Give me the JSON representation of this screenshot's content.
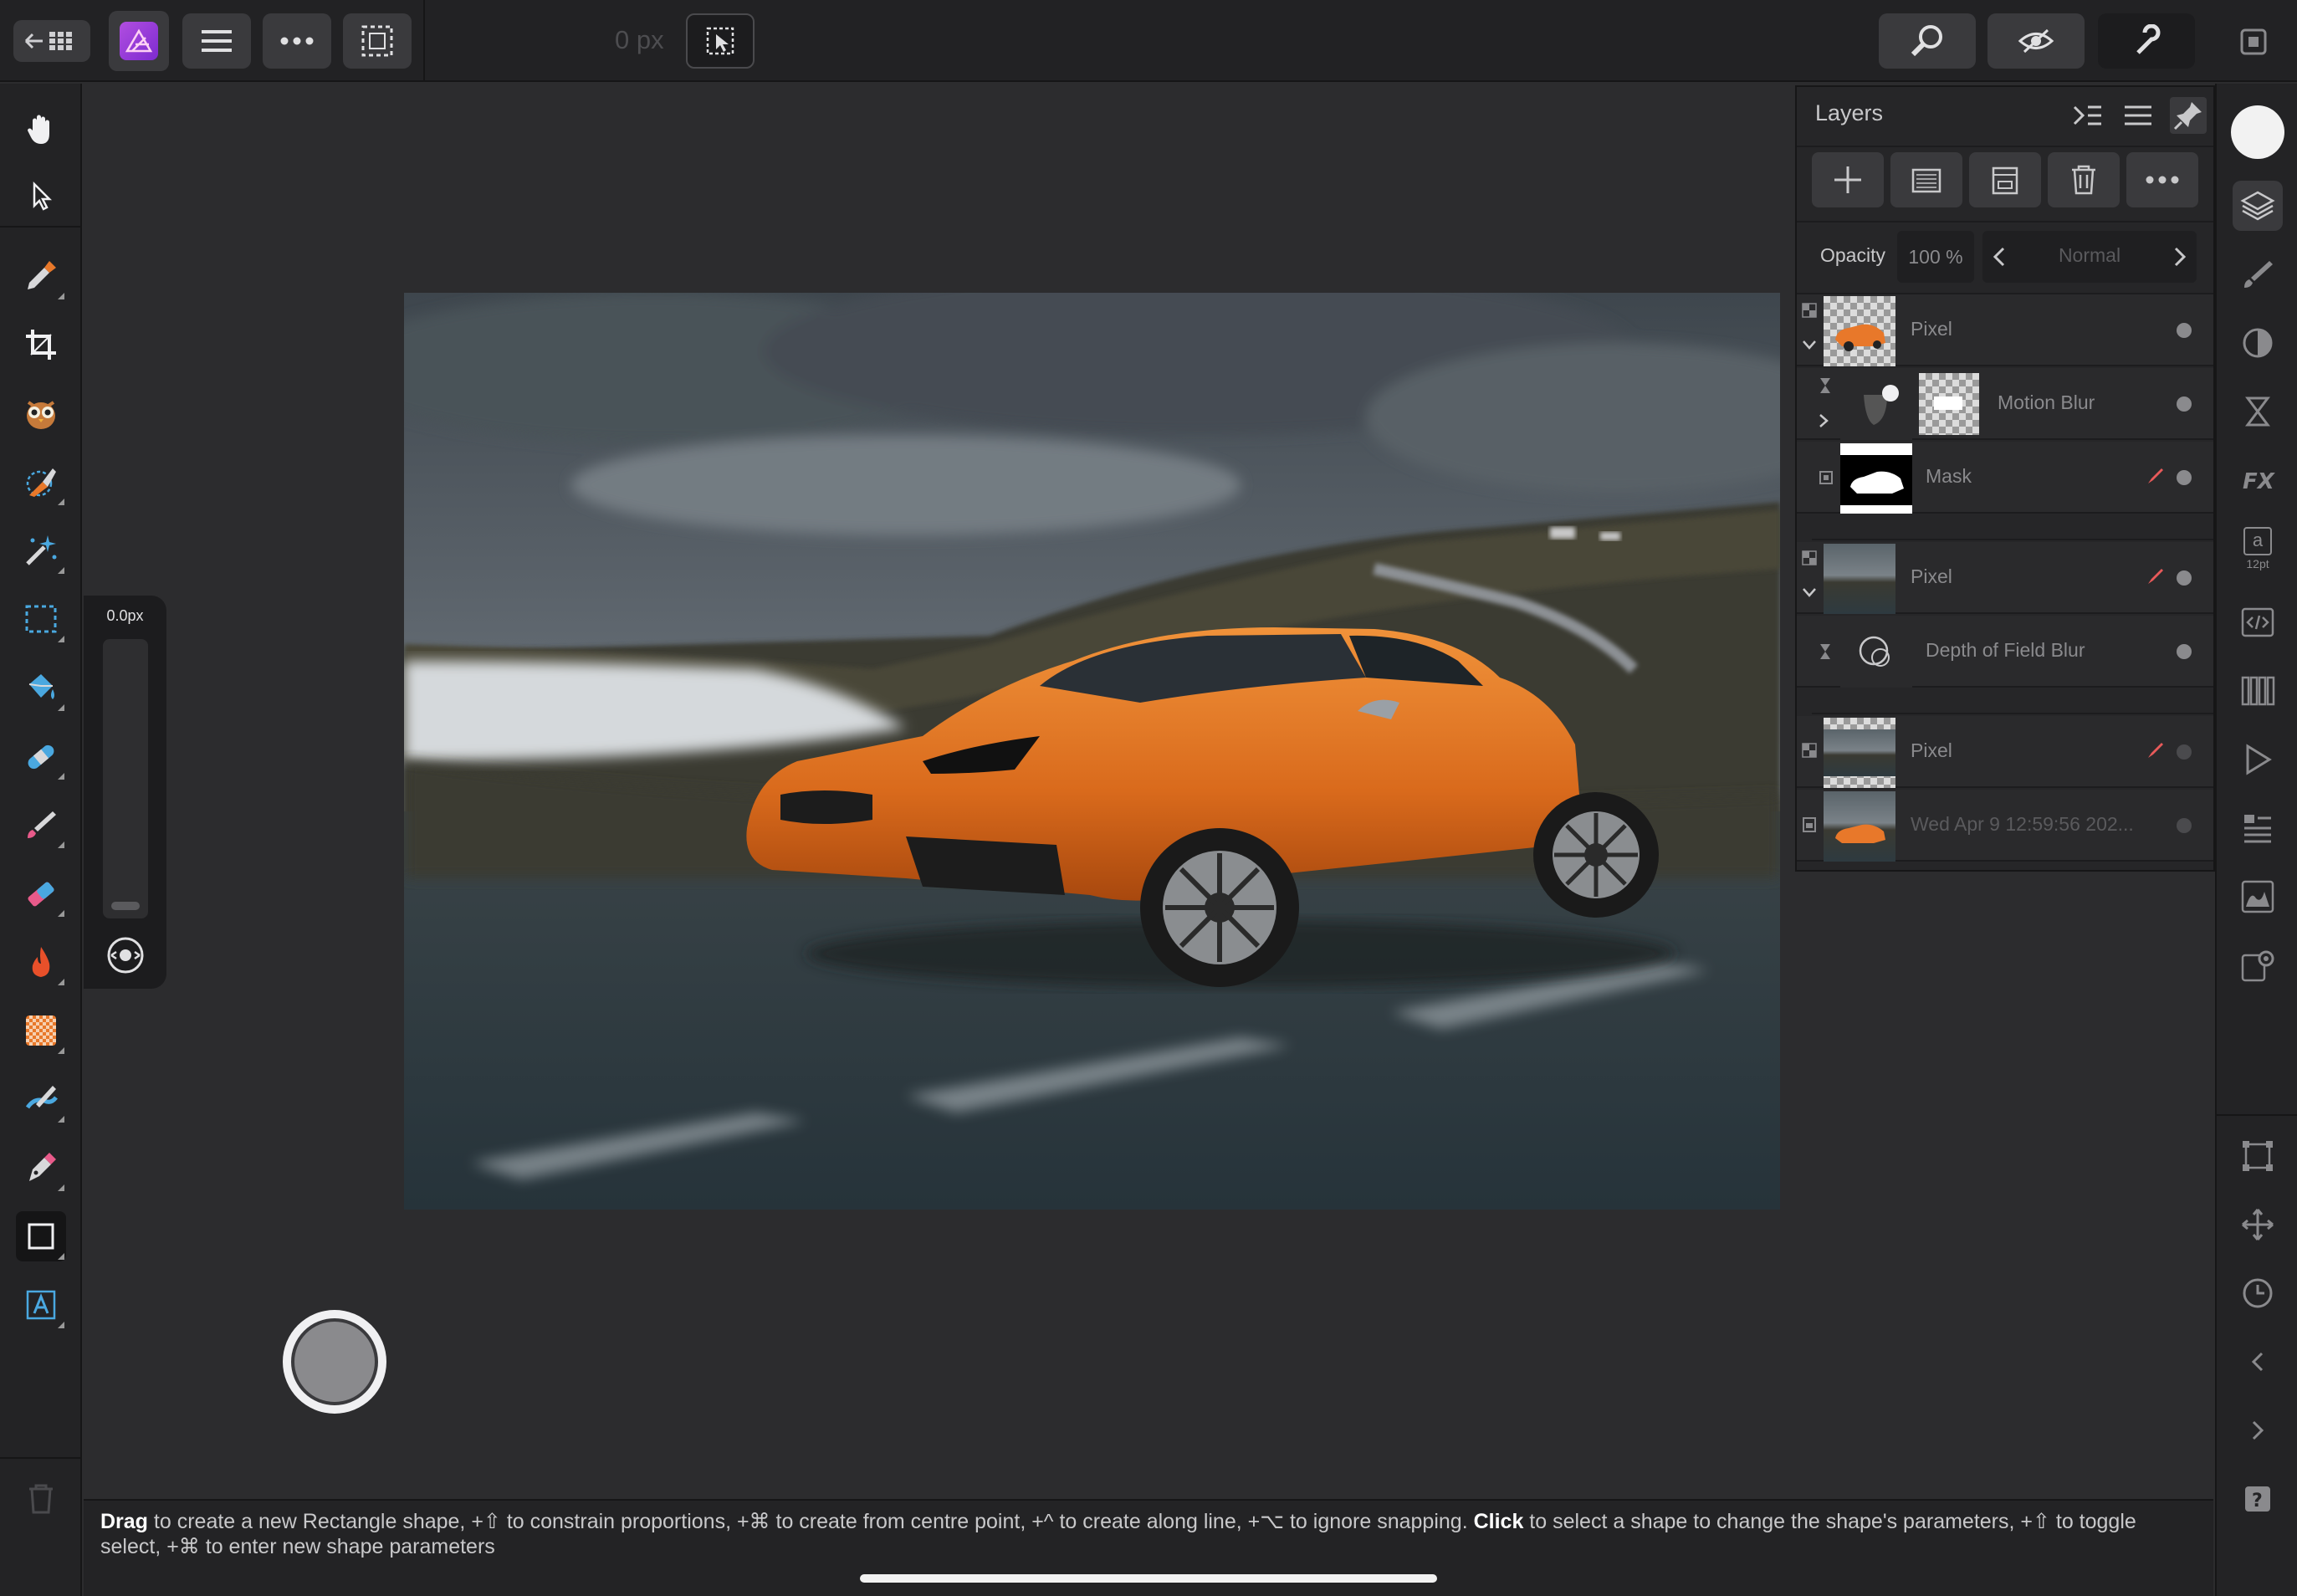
{
  "topbar": {
    "back_grid_icon": "back-grid-icon",
    "app_icon": "affinity-photo-icon",
    "menu_icon": "hamburger-menu-icon",
    "more_icon": "more-dots-icon",
    "selection_icon": "selection-marquee-icon",
    "px_readout": "0 px",
    "transform_icon": "transform-select-icon",
    "right_buttons": [
      "zoom-icon",
      "view-mode-icon",
      "snapping-icon"
    ],
    "window_icon": "window-icon"
  },
  "tools": [
    "hand-tool-icon",
    "move-tool-icon",
    "color-picker-icon",
    "crop-tool-icon",
    "refine-selection-icon",
    "selection-brush-icon",
    "magic-wand-icon",
    "rectangle-marquee-icon",
    "flood-fill-icon",
    "healing-brush-icon",
    "paint-brush-icon",
    "eraser-icon",
    "burn-dodge-icon",
    "pattern-stamp-icon",
    "smudge-icon",
    "pen-tool-icon",
    "rectangle-tool-icon",
    "text-tool-icon",
    "trash-icon"
  ],
  "size_panel": {
    "value": "0.0px",
    "level": 0.0
  },
  "layers_panel": {
    "title": "Layers",
    "opacity_label": "Opacity",
    "opacity_value": "100 %",
    "blend_mode": "Normal",
    "toolbar_icons": [
      "add-layer-icon",
      "add-mask-icon",
      "group-icon",
      "delete-layer-icon",
      "more-dots-icon"
    ],
    "layers": [
      {
        "name": "Pixel"
      },
      {
        "name": "Motion Blur"
      },
      {
        "name": "Mask"
      },
      {
        "name": "Pixel"
      },
      {
        "name": "Depth of Field Blur"
      },
      {
        "name": "Pixel"
      },
      {
        "name": "Wed Apr  9 12:59:56 202..."
      }
    ]
  },
  "right_strip": {
    "color_swatch": "#f2f2f2",
    "icons": [
      "layers-studio-icon",
      "brushes-icon",
      "adjustments-icon",
      "filters-icon",
      "fx-icon",
      "text-styles-icon",
      "code-icon",
      "swatches-icon",
      "play-icon",
      "navigator-icon",
      "histogram-icon",
      "settings-icon",
      "transform-icon",
      "move-icon",
      "history-icon",
      "chevron-left-icon",
      "chevron-right-icon",
      "help-icon"
    ],
    "text_label": "a",
    "text_size": "12pt"
  },
  "status": {
    "drag": "Drag",
    "drag_text": " to create a new Rectangle shape, +⇧ to constrain proportions, +⌘ to create from centre point, +^ to create along line, +⌥ to ignore snapping. ",
    "click": "Click",
    "click_text": " to select a shape to change the shape's parameters, +⇧ to toggle select, +⌘ to enter new shape parameters"
  },
  "colors": {
    "accent_orange": "#e8782a",
    "background": "#2c2c2e",
    "panel": "#262628"
  }
}
